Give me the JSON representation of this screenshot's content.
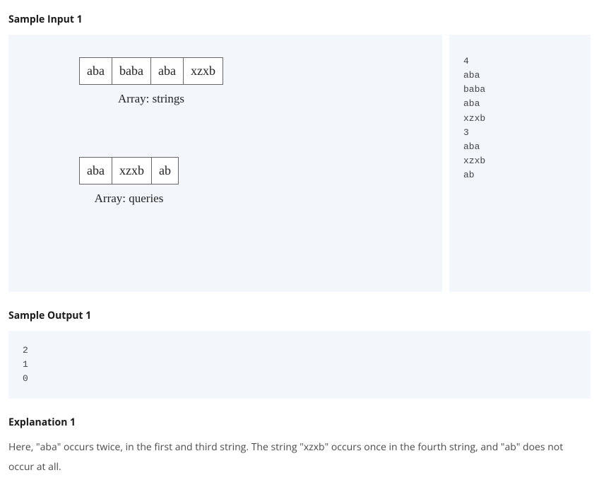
{
  "headings": {
    "sample_input": "Sample Input 1",
    "sample_output": "Sample Output 1",
    "explanation": "Explanation 1"
  },
  "diagram": {
    "arrays": [
      {
        "cells": [
          "aba",
          "baba",
          "aba",
          "xzxb"
        ],
        "caption": "Array: strings"
      },
      {
        "cells": [
          "aba",
          "xzxb",
          "ab"
        ],
        "caption": "Array: queries"
      }
    ]
  },
  "input_text": "4\naba\nbaba\naba\nxzxb\n3\naba\nxzxb\nab",
  "output_text": "2\n1\n0",
  "explanation_text": "Here, \"aba\" occurs twice, in the first and third string. The string \"xzxb\" occurs once in the fourth string, and \"ab\" does not occur at all."
}
